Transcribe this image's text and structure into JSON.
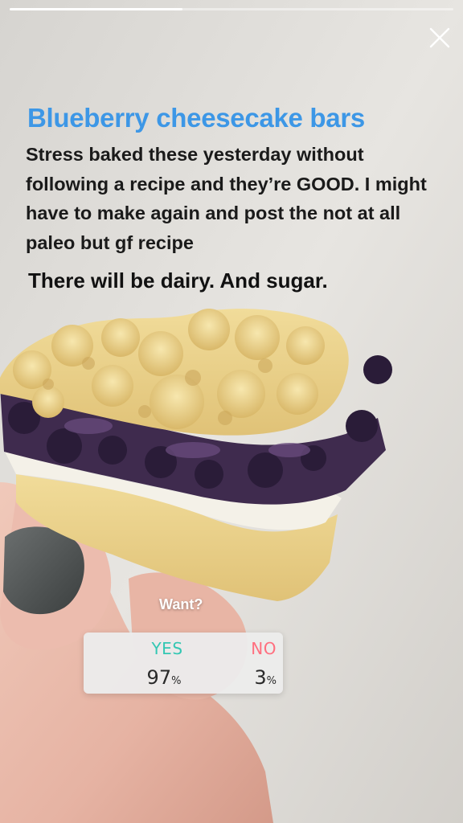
{
  "story": {
    "progress": 0.39,
    "title": "Blueberry cheesecake bars",
    "caption": "Stress baked these yesterday without following a recipe and they’re GOOD. I might have to make again and post the not at all paleo but gf recipe",
    "subcaption": "There will be dairy. And sugar.",
    "close_icon": "close-icon"
  },
  "poll": {
    "question": "Want?",
    "options": [
      {
        "label": "YES",
        "percent": "97",
        "color": "#33c7b3"
      },
      {
        "label": "NO",
        "percent": "3",
        "color": "#ff6f7f"
      }
    ],
    "percent_sign": "%"
  },
  "colors": {
    "title": "#3d97e6",
    "text": "#1a1a1a"
  }
}
